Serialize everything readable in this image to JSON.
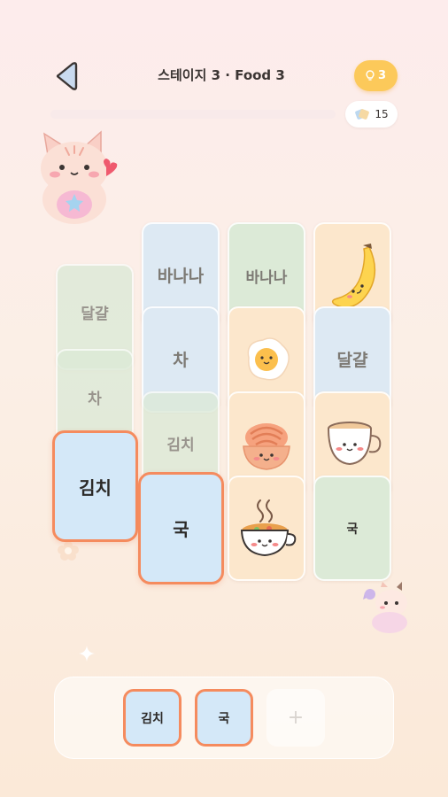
{
  "header": {
    "back_icon": "back-arrow-icon",
    "title": "스테이지 3 · Food 3",
    "hints": "3",
    "hint_icon": "lightbulb-icon",
    "moves": "15",
    "moves_icon": "bandage-icon",
    "progress": 0.0
  },
  "board": {
    "col1": {
      "card1_label": "달걀",
      "card2_label": "차",
      "card3_label": "김치"
    },
    "col2": {
      "card1_label": "바나나",
      "card2_label": "차",
      "card3_label": "김치",
      "card4_label": "국"
    },
    "col3": {
      "card1_label": "바나나",
      "card2_icon": "fried-egg-icon",
      "card3_icon": "noodle-bowl-icon",
      "card4_icon": "soup-bowl-icon"
    },
    "col4": {
      "card1_icon": "banana-icon",
      "card2_label": "달걀",
      "card3_icon": "tea-cup-icon",
      "card4_label": "국"
    }
  },
  "tray": {
    "slot1": "김치",
    "slot2": "국",
    "slot3": "+"
  },
  "decor": {
    "top_mascot": "cat-mascot-icon",
    "bottom_mascot": "cat-mascot-icon",
    "sparkle": "sparkle-icon",
    "flower": "flower-icon"
  },
  "colors": {
    "accent": "#f58b5e",
    "hint_yellow": "#fcc95a",
    "card_green": "#dcead7",
    "card_blue": "#dde9f3",
    "card_peach": "#fce7cc",
    "selected_blue": "#d4e8f8"
  }
}
